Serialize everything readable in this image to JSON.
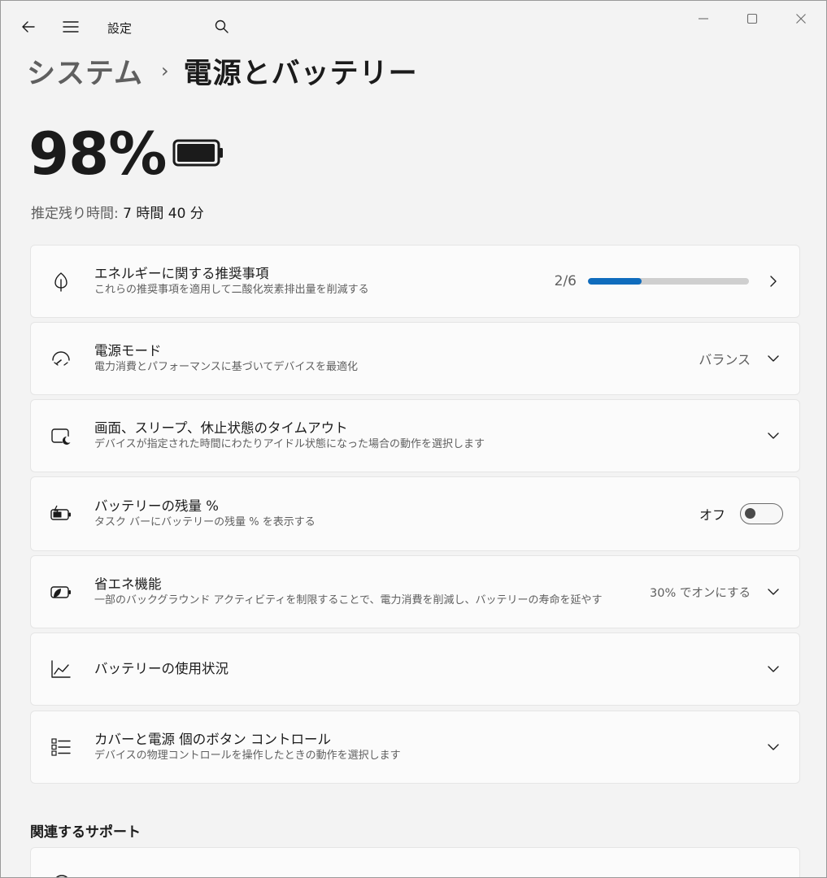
{
  "titlebar": {
    "title": "設定",
    "back_icon": "back-arrow-icon",
    "menu_icon": "hamburger-menu-icon",
    "search_icon": "search-icon"
  },
  "breadcrumb": {
    "parent": "システム",
    "separator": "›",
    "current": "電源とバッテリー"
  },
  "battery": {
    "percent_text": "98%",
    "level": 0.98,
    "remaining_label": "推定残り時間:",
    "remaining_value": "7 時間 40 分"
  },
  "cards": {
    "energy": {
      "title": "エネルギーに関する推奨事項",
      "subtitle": "これらの推奨事項を適用して二酸化炭素排出量を削減する",
      "progress_text": "2/6",
      "progress_fraction": 0.333
    },
    "power_mode": {
      "title": "電源モード",
      "subtitle": "電力消費とパフォーマンスに基づいてデバイスを最適化",
      "value": "バランス"
    },
    "screen_sleep": {
      "title": "画面、スリープ、休止状態のタイムアウト",
      "subtitle": "デバイスが指定された時間にわたりアイドル状態になった場合の動作を選択します"
    },
    "battery_percent": {
      "title": "バッテリーの残量 %",
      "subtitle": "タスク バーにバッテリーの残量 % を表示する",
      "toggle_label": "オフ",
      "toggle_on": false
    },
    "energy_saver": {
      "title": "省エネ機能",
      "subtitle": "一部のバックグラウンド アクティビティを制限することで、電力消費を削減し、バッテリーの寿命を延やす",
      "value": "30% でオンにする"
    },
    "battery_usage": {
      "title": "バッテリーの使用状況"
    },
    "lid_power": {
      "title": "カバーと電源 個のボタン コントロール",
      "subtitle": "デバイスの物理コントロールを操作したときの動作を選択します"
    }
  },
  "related_support": {
    "heading": "関連するサポート"
  },
  "colors": {
    "accent": "#0f6cbd",
    "background": "#f3f3f3",
    "card": "#fbfbfb"
  }
}
